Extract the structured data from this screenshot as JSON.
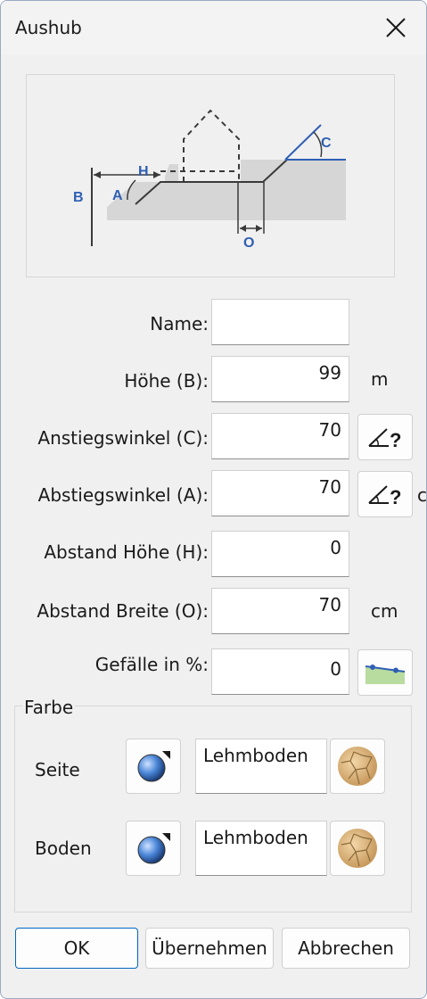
{
  "window": {
    "title": "Aushub"
  },
  "diagram": {
    "labels": {
      "b": "B",
      "h": "H",
      "a": "A",
      "c": "C",
      "o": "O"
    }
  },
  "fields": [
    {
      "label": "Name:",
      "value": "",
      "unit": ""
    },
    {
      "label": "Höhe (B):",
      "value": "99",
      "unit": "m"
    },
    {
      "label": "Anstiegswinkel (C):",
      "value": "70",
      "unit": ""
    },
    {
      "label": "Abstiegswinkel (A):",
      "value": "70",
      "unit": "c"
    },
    {
      "label": "Abstand Höhe (H):",
      "value": "0",
      "unit": ""
    },
    {
      "label": "Abstand Breite (O):",
      "value": "70",
      "unit": "cm"
    },
    {
      "label": "Gefälle in %:",
      "value": "0",
      "unit": ""
    }
  ],
  "color_group": {
    "title": "Farbe",
    "rows": [
      {
        "label": "Seite",
        "material": "Lehmboden "
      },
      {
        "label": "Boden",
        "material": "Lehmboden "
      }
    ]
  },
  "buttons": {
    "ok": "OK",
    "apply": "Übernehmen",
    "cancel": "Abbrechen"
  },
  "colors": {
    "accent_blue": "#2f5fb3",
    "border_focus": "#0067c0",
    "ground_gray": "#d6d6d6"
  }
}
